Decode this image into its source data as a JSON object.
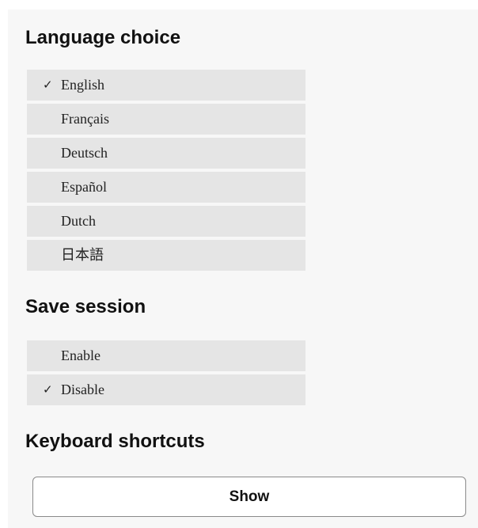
{
  "language": {
    "title": "Language choice",
    "check_mark": "✓",
    "options": [
      {
        "label": "English",
        "selected": true
      },
      {
        "label": "Français",
        "selected": false
      },
      {
        "label": "Deutsch",
        "selected": false
      },
      {
        "label": "Español",
        "selected": false
      },
      {
        "label": "Dutch",
        "selected": false
      },
      {
        "label": "日本語",
        "selected": false
      }
    ]
  },
  "session": {
    "title": "Save session",
    "check_mark": "✓",
    "options": [
      {
        "label": "Enable",
        "selected": false
      },
      {
        "label": "Disable",
        "selected": true
      }
    ]
  },
  "shortcuts": {
    "title": "Keyboard shortcuts",
    "button_label": "Show"
  },
  "colors": {
    "panel_background": "#f7f7f7",
    "option_background": "#e5e5e5",
    "button_border": "#8a8a8a"
  },
  "icons": {
    "selected_indicator": "check-icon"
  }
}
